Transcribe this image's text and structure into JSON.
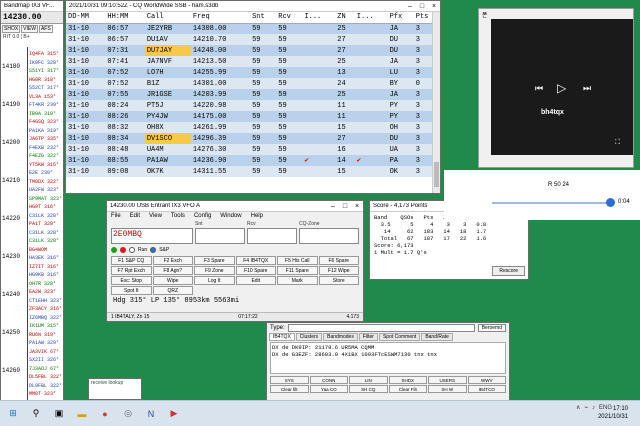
{
  "bandmap": {
    "title": "Bandmap IX3 VF...",
    "frequency": "14230.00",
    "tools": [
      "SHOX",
      "VIEW",
      "AFS"
    ],
    "mini": "RIT 0.0  ¦  B+",
    "scale_labels": [
      "14180",
      "14190",
      "14200",
      "14210",
      "14220",
      "14230",
      "14240",
      "14250",
      "14260",
      "14270"
    ],
    "spots": [
      "IQ4FA 315°",
      "IK9FC 328°",
      "S51YI 317°",
      "HG0R 318°",
      "S52CT 317°",
      "VL3A 153°",
      "FT4KR 239°",
      "IB9A 310°",
      "F4GSQ 323°",
      "PA1KA 319°",
      "JA6TP 335°",
      "F4EXB 232°",
      "F4EZG 322°",
      "YT5KW 316°",
      "E2E 230°",
      "TM0DX 322°",
      "UA2FW 323°",
      "SP9MAT 323°",
      "HG9T 316°",
      "C31LK 328°",
      "PA1T 328°",
      "C31LK 328°",
      "C31LK 328°",
      "BG4WOM",
      "HA3EK 316°",
      "IZ7IT 316°",
      "HG9KB 316°",
      "OH7R 328°",
      "EA2W 323°",
      "CT1EHH 323°",
      "ZF3ACY 316°",
      "IZ6MBQ 322°",
      "IK1UM 315°",
      "RU6N 310°",
      "PA1AW 329°",
      "JA3VIK 67°",
      "SX2II 326°",
      "7J3AOJ 67°",
      "DL5FBL 322°",
      "DL9FBL 322°",
      "MM0T 323°",
      "EA1BJ 322°"
    ]
  },
  "log": {
    "title": "2021/10/31 09:10:52Z - CQ WorldWide SSB - ham.s3db",
    "columns": [
      "DD-MM",
      "HH:MM",
      "Call",
      "Freq",
      "Snt",
      "Rcv",
      "I...",
      "ZN",
      "I...",
      "Pfx",
      "Pts"
    ],
    "rows": [
      {
        "d": "31-10",
        "t": "06:57",
        "call": "JE2YRB",
        "freq": "14308.00",
        "snt": "59",
        "rcv": "59",
        "i1": "",
        "zn": "25",
        "i2": "",
        "pfx": "JA",
        "pts": "3",
        "hl": false,
        "chk": false
      },
      {
        "d": "31-10",
        "t": "06:57",
        "call": "DU1AV",
        "freq": "14210.70",
        "snt": "59",
        "rcv": "59",
        "i1": "",
        "zn": "27",
        "i2": "",
        "pfx": "DU",
        "pts": "3",
        "hl": false,
        "chk": false
      },
      {
        "d": "31-10",
        "t": "07:31",
        "call": "DU7JAY",
        "freq": "14248.00",
        "snt": "59",
        "rcv": "59",
        "i1": "",
        "zn": "27",
        "i2": "",
        "pfx": "DU",
        "pts": "3",
        "hl": true,
        "chk": false
      },
      {
        "d": "31-10",
        "t": "07:41",
        "call": "JA7NVF",
        "freq": "14213.50",
        "snt": "59",
        "rcv": "59",
        "i1": "",
        "zn": "25",
        "i2": "",
        "pfx": "JA",
        "pts": "3",
        "hl": false,
        "chk": false
      },
      {
        "d": "31-10",
        "t": "07:52",
        "call": "LO7H",
        "freq": "14255.99",
        "snt": "59",
        "rcv": "59",
        "i1": "",
        "zn": "13",
        "i2": "",
        "pfx": "LU",
        "pts": "3",
        "hl": false,
        "chk": false
      },
      {
        "d": "31-10",
        "t": "07:52",
        "call": "B1Z",
        "freq": "14301.00",
        "snt": "59",
        "rcv": "59",
        "i1": "",
        "zn": "24",
        "i2": "",
        "pfx": "BY",
        "pts": "0",
        "hl": false,
        "chk": false
      },
      {
        "d": "31-10",
        "t": "07:55",
        "call": "JR1GSE",
        "freq": "14203.99",
        "snt": "59",
        "rcv": "59",
        "i1": "",
        "zn": "25",
        "i2": "",
        "pfx": "JA",
        "pts": "3",
        "hl": false,
        "chk": false
      },
      {
        "d": "31-10",
        "t": "08:24",
        "call": "PT5J",
        "freq": "14220.98",
        "snt": "59",
        "rcv": "59",
        "i1": "",
        "zn": "11",
        "i2": "",
        "pfx": "PY",
        "pts": "3",
        "hl": false,
        "chk": false
      },
      {
        "d": "31-10",
        "t": "08:26",
        "call": "PY4JW",
        "freq": "14175.00",
        "snt": "59",
        "rcv": "59",
        "i1": "",
        "zn": "11",
        "i2": "",
        "pfx": "PY",
        "pts": "3",
        "hl": false,
        "chk": false
      },
      {
        "d": "31-10",
        "t": "08:32",
        "call": "OH8X",
        "freq": "14261.99",
        "snt": "59",
        "rcv": "59",
        "i1": "",
        "zn": "15",
        "i2": "",
        "pfx": "OH",
        "pts": "3",
        "hl": false,
        "chk": false
      },
      {
        "d": "31-10",
        "t": "08:34",
        "call": "DV1SCO",
        "freq": "14296.39",
        "snt": "59",
        "rcv": "59",
        "i1": "",
        "zn": "27",
        "i2": "",
        "pfx": "DU",
        "pts": "3",
        "hl": true,
        "chk": false
      },
      {
        "d": "31-10",
        "t": "08:48",
        "call": "UA4M",
        "freq": "14276.30",
        "snt": "59",
        "rcv": "59",
        "i1": "",
        "zn": "16",
        "i2": "",
        "pfx": "UA",
        "pts": "3",
        "hl": false,
        "chk": false
      },
      {
        "d": "31-10",
        "t": "08:55",
        "call": "PA1AW",
        "freq": "14236.90",
        "snt": "59",
        "rcv": "59",
        "i1": "✔",
        "zn": "14",
        "i2": "✔",
        "pfx": "PA",
        "pts": "3",
        "hl": false,
        "chk": true
      },
      {
        "d": "31-10",
        "t": "09:08",
        "call": "OK7K",
        "freq": "14311.55",
        "snt": "59",
        "rcv": "59",
        "i1": "",
        "zn": "15",
        "i2": "",
        "pfx": "OK",
        "pts": "3",
        "hl": false,
        "chk": false
      }
    ]
  },
  "entry": {
    "title": "14230.00 USB Entrant IX3 VFO A",
    "menus": [
      "File",
      "Edit",
      "View",
      "Tools",
      "Config",
      "Window",
      "Help"
    ],
    "field_labels": [
      "",
      "Snt",
      "Rcv",
      "CQ-Zone"
    ],
    "call_value": "2E0MBQ",
    "radio_labels": [
      "Run",
      "S&P"
    ],
    "keys": [
      "F1 S&P CQ",
      "F2 Exch",
      "F3 Spare",
      "F4 IB4TQX",
      "F5 His Call",
      "F6 Spare",
      "F7 Rpt Exch",
      "F8 Agn?",
      "F9 Zone",
      "F10 Spare",
      "F11 Spare",
      "F12 Wipe",
      "Esc: Stop",
      "Wipe",
      "Log It",
      "Edit",
      "Mark",
      "Store",
      "Spot It",
      "QRZ"
    ],
    "info": "Hdg 315° LP 135° 8953km 5563mi",
    "status_left": "1  IB4TALY, Zn 15",
    "status_mid": "07:17:22",
    "status_right": "4.173"
  },
  "score": {
    "title": "Score - 4,173 Points",
    "text": "Band    QSOs   Pts   ZN  Cty  Pt/Q\n  3.5      5     4    3    3   0.8\n   14     62   183   14   18   1.7\n  Total   67   187   17   22   1.6\nScore: 6,173\n1 Mult = 1.7 Q's",
    "rescore": "Rescore"
  },
  "telnet": {
    "type_label": "Type:",
    "select": "Beroemd",
    "tabs": [
      "IB4TQX",
      "Clusters",
      "Bandmodes",
      "Filter",
      "Spot Comment",
      "Band/Rate"
    ],
    "spots": [
      "DX de DK9IP:    21179.6  UR5MA                 CQMM",
      "DX de G3EZF:    28603.0  4X1BX                 1093FTcESWM7130 tnx tnx"
    ],
    "buttons": [
      "SYS",
      "CONN",
      "LIN",
      "SHDX",
      "USERS",
      "WWV",
      "Clear filt",
      "Yaa CO",
      "SH CQ",
      "Clear Filt",
      "SH W",
      "IB4TCO"
    ]
  },
  "player": {
    "header": "폰",
    "name": "bh4tqx",
    "position_label": "R 50 24",
    "time": "0:04"
  },
  "netwin": {
    "text": "receive lookup"
  },
  "taskbar": {
    "tray_lang": "ENG",
    "time": "17:10",
    "date": "2021/10/31"
  }
}
